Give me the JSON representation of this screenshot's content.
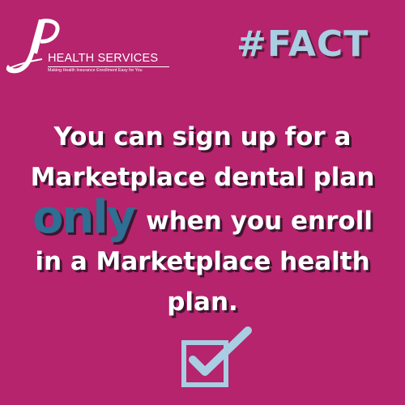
{
  "brand": {
    "monogram": "JP",
    "name": "HEALTH SERVICES",
    "tagline": "Making Health Insurance Enrollment Easy for You"
  },
  "hashtag": "#FACT",
  "fact": {
    "line1": "You can sign up for a",
    "line2": "Marketplace dental plan",
    "emphasis": "only",
    "line3_rest": "when you enroll",
    "line4": "in a Marketplace health",
    "line5": "plan."
  },
  "icons": {
    "checkmark": "checkbox-check-icon"
  },
  "colors": {
    "background": "#b5246d",
    "accent_light_blue": "#a9cde2",
    "accent_dark_blue": "#2e6f93",
    "text": "#ffffff"
  }
}
